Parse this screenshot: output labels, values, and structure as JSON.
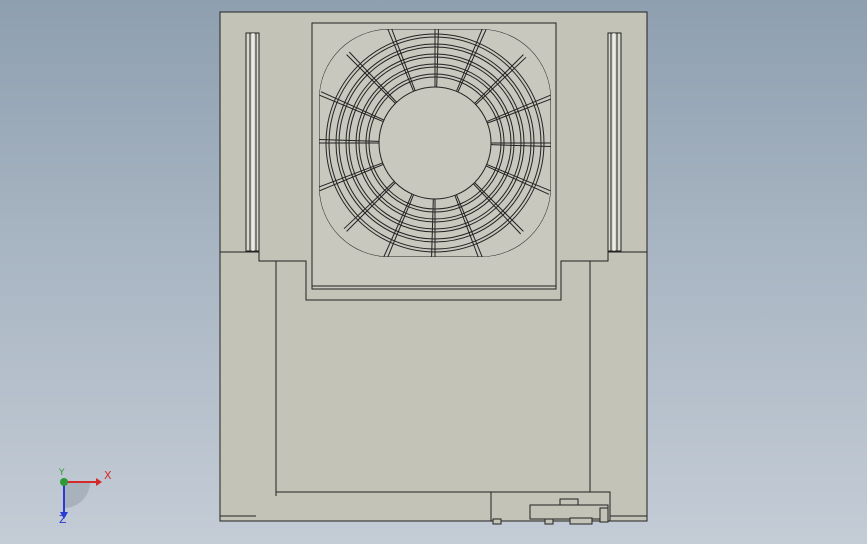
{
  "scene": {
    "background_top": "#8e9fb0",
    "background_bottom": "#c4ccd6",
    "body_color": "#c3c3b8",
    "edge_color": "#222222"
  },
  "triad": {
    "x_label": "X",
    "y_label": "Y",
    "z_label": "Z",
    "x_color": "#d42a2a",
    "y_color": "#2e9a35",
    "z_color": "#2a3ad2"
  }
}
